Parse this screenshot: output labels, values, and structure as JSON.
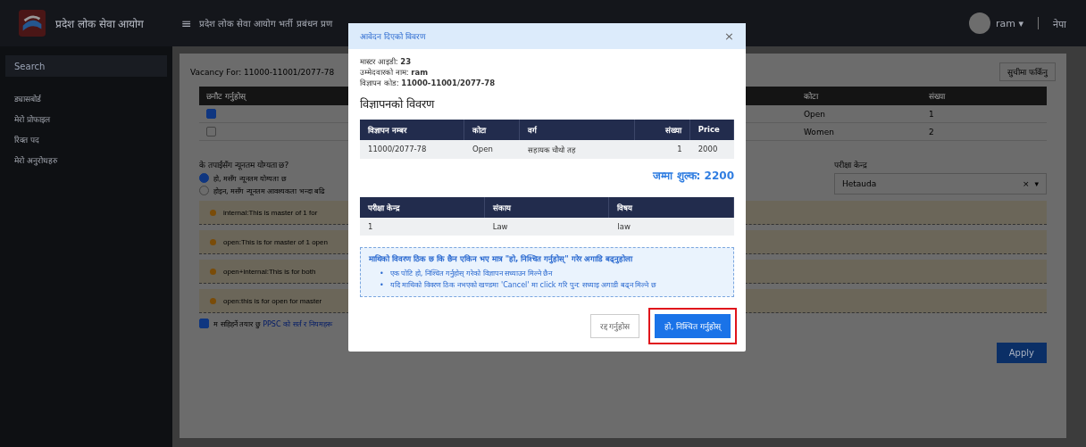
{
  "header": {
    "brand": "प्रदेश लोक सेवा आयोग",
    "menu_glyph": "≡",
    "title": "प्रदेश लोक सेवा आयोग भर्ती प्रबंधन प्रण",
    "user": "ram",
    "user_caret": "▾",
    "lang": "नेपा"
  },
  "sidebar": {
    "search": {
      "placeholder": "Search"
    },
    "items": [
      {
        "label": "ड्यासबोर्ड"
      },
      {
        "label": "मेरो प्रोफाइल"
      },
      {
        "label": "रिक्त पद"
      },
      {
        "label": "मेरो अनुरोधहरु"
      }
    ]
  },
  "page": {
    "vacancy": "Vacancy For: 11000-11001/2077-78",
    "back_button": "सुचीमा फर्किनु",
    "table": {
      "columns": [
        "छनौट गर्नुहोस्",
        "कोटा",
        "संख्या"
      ],
      "rows": [
        {
          "checked": true,
          "quota": "Open",
          "count": "1"
        },
        {
          "checked": false,
          "quota": "Women",
          "count": "2"
        }
      ]
    },
    "question": "के तपाईंसँग न्यूनतम योग्यता छ?",
    "options": [
      {
        "label": "हो, मसँग न्यूनतम योग्यता छ",
        "selected": true
      },
      {
        "label": "होइन, मसँग न्यूनतम आवश्यकता भन्दा बढि",
        "selected": false
      }
    ],
    "exam_center": {
      "label": "परीक्षा केन्द्र",
      "value": "Hetauda",
      "clear": "×",
      "caret": "▾"
    },
    "notices": [
      "internal:This is master of 1 for",
      "open:This is for master of 1 open",
      "open+internal:This is for both",
      "open:this is for open for master"
    ],
    "agree": {
      "checked": true,
      "text": "म सहिहर्ने तयार छु",
      "link": "PPSC को सर्त र नियमहरू"
    },
    "apply": "Apply"
  },
  "modal": {
    "title": "आवेदन दिएको विवरण",
    "close": "×",
    "info": [
      "मास्टर आइडी: **23**",
      "उम्मेदवारको नाम: **ram**",
      "विज्ञापन कोड: **11000-11001/2077-78**"
    ],
    "heading": "विज्ञापनको विवरण",
    "ad_table": {
      "columns": [
        "विज्ञापन नम्बर",
        "कोटा",
        "वर्ग",
        "संख्या",
        "Price"
      ],
      "rows": [
        [
          "11000/2077-78",
          "Open",
          "सहायक चौथो तह",
          "1",
          "2000"
        ]
      ]
    },
    "total": "जम्मा शुल्क: 2200",
    "exam_table": {
      "columns": [
        "परीक्षा केन्द्र",
        "संकाय",
        "विषय"
      ],
      "rows": [
        [
          "1",
          "Law",
          "law"
        ]
      ]
    },
    "notice": {
      "title": "माथिको विवरण ठिक छ कि छैन एकिन भए मात्र \"हो, निश्चित गर्नुहोस्\" गरेर अगाडि बढ्नुहोला",
      "bullet": "•",
      "bullets": [
        "एक पोटि हो, निश्चित गर्नुहोस् गरेको विज्ञापन सच्याउन मिल्ने छैन",
        "यदि माथिको विवरण ठिक नभएको खण्डमा 'Cancel' मा click गरि पुन: सच्याइ अगाडी बढ्न मिल्ने छ"
      ]
    },
    "cancel": "रद्द गर्नुहोस",
    "confirm": "हो, निश्चित गर्नुहोस्",
    "confirm_highlighted": true
  }
}
